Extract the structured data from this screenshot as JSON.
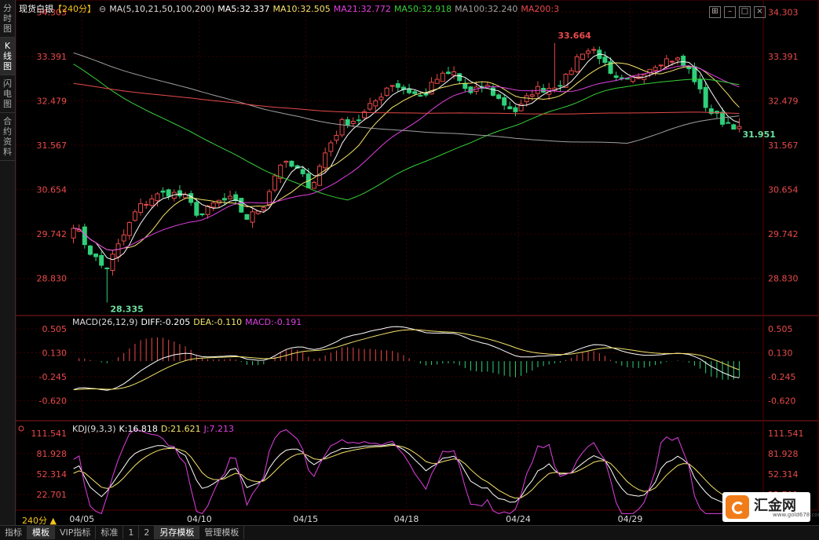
{
  "nav_tabs": [
    {
      "label": "分时图",
      "active": false
    },
    {
      "label": "K线图",
      "active": true
    },
    {
      "label": "闪电图",
      "active": false
    },
    {
      "label": "合约资料",
      "active": false
    }
  ],
  "header": {
    "instrument": "现货白银",
    "period": "【240分】",
    "ma_label": "MA(5,10,21,50,100,200)",
    "ma5": "MA5:32.337",
    "ma10": "MA10:32.505",
    "ma21": "MA21:32.772",
    "ma50": "MA50:32.918",
    "ma100": "MA100:32.240",
    "ma200": "MA200:3"
  },
  "macd_legend": {
    "name": "MACD(26,12,9)",
    "diff": "DIFF:-0.205",
    "dea": "DEA:-0.110",
    "macd": "MACD:-0.191"
  },
  "kdj_legend": {
    "name": "KDJ(9,3,3)",
    "k": "K:16.818",
    "d": "D:21.621",
    "j": "J:7.213"
  },
  "bottom_tabs": [
    {
      "label": "指标",
      "active": false
    },
    {
      "label": "模板",
      "active": true
    },
    {
      "label": "VIP指标",
      "active": false
    },
    {
      "label": "标准",
      "active": false
    },
    {
      "label": "1",
      "active": false
    },
    {
      "label": "2",
      "active": false
    },
    {
      "label": "另存模板",
      "active": true
    },
    {
      "label": "管理模板",
      "active": false
    }
  ],
  "period_label": "240分 ▲",
  "logo": {
    "name": "汇金网",
    "url": "www.gold678.com"
  },
  "colors": {
    "up": "#e84a4a",
    "down": "#2fd07a",
    "grid": "#3a0000",
    "axis": "#e84a4a",
    "ma5": "#ffffff",
    "ma10": "#f5e36a",
    "ma21": "#e040e0",
    "ma50": "#38d038",
    "ma100": "#a0a0a0",
    "ma200": "#e84a4a",
    "diff": "#ffffff",
    "dea": "#f5e36a",
    "k": "#ffffff",
    "d": "#f5e36a",
    "j": "#e040e0"
  },
  "chart_data": [
    {
      "type": "candlestick",
      "panel": "price",
      "y_ticks": [
        34.303,
        33.391,
        32.479,
        31.567,
        30.654,
        29.742,
        28.83
      ],
      "ylim": [
        28.1,
        34.42
      ],
      "x_ticks": [
        "04/05",
        "04/10",
        "04/15",
        "04/18",
        "04/24",
        "04/29"
      ],
      "annotations": [
        {
          "text": "33.664",
          "value": 33.664,
          "kind": "high"
        },
        {
          "text": "28.335",
          "value": 28.335,
          "kind": "low"
        },
        {
          "text": "31.951",
          "value": 31.951,
          "kind": "last"
        }
      ],
      "ohlc_anchor": [
        29.95,
        29.4,
        29.0,
        29.6,
        30.25,
        30.5,
        30.6,
        30.5,
        30.1,
        30.4,
        30.45,
        30.05,
        30.35,
        31.2,
        31.1,
        30.7,
        31.5,
        32.05,
        32.1,
        32.45,
        32.85,
        32.7,
        32.55,
        32.95,
        33.05,
        32.6,
        32.8,
        32.45,
        32.25,
        32.7,
        32.75,
        32.9,
        33.5,
        33.52,
        32.9,
        32.85,
        33.1,
        33.3,
        33.35,
        33.05,
        32.3,
        32.05,
        31.95
      ],
      "series": [
        {
          "name": "MA5"
        },
        {
          "name": "MA10"
        },
        {
          "name": "MA21"
        },
        {
          "name": "MA50"
        },
        {
          "name": "MA100"
        },
        {
          "name": "MA200"
        }
      ]
    },
    {
      "type": "bar",
      "panel": "macd",
      "y_ticks": [
        0.505,
        0.13,
        -0.245,
        -0.62
      ],
      "ylim": [
        -0.9,
        0.68
      ],
      "series": [
        {
          "name": "DIFF"
        },
        {
          "name": "DEA"
        },
        {
          "name": "MACD"
        }
      ]
    },
    {
      "type": "line",
      "panel": "kdj",
      "y_ticks": [
        111.541,
        81.928,
        52.314,
        22.701
      ],
      "ylim": [
        0,
        125
      ],
      "series": [
        {
          "name": "K"
        },
        {
          "name": "D"
        },
        {
          "name": "J"
        }
      ]
    }
  ]
}
